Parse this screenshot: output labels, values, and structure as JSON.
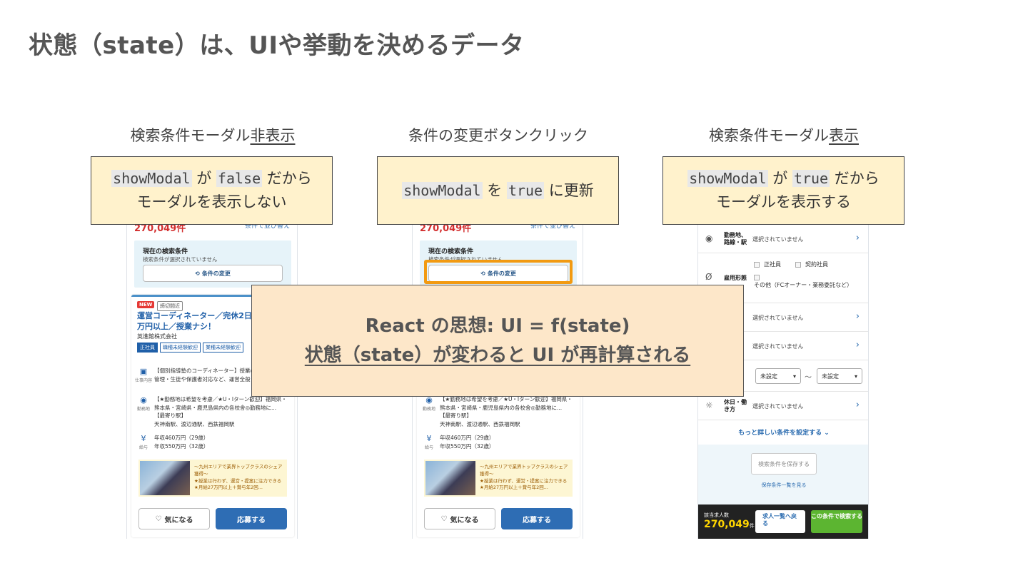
{
  "slide": {
    "title": "状態（state）は、UIや挙動を決めるデータ"
  },
  "columns": [
    {
      "title_pre": "検索条件モーダル",
      "title_emph": "非表示",
      "note_code1": "showModal",
      "note_mid": " が ",
      "note_code2": "false",
      "note_post": " だから",
      "note_line2": "モーダルを表示しない"
    },
    {
      "title_pre": "条件の変更ボタンクリック",
      "title_emph": "",
      "note_code1": "showModal",
      "note_mid": " を ",
      "note_code2": "true",
      "note_post": " に更新",
      "note_line2": ""
    },
    {
      "title_pre": "検索条件モーダル",
      "title_emph": "表示",
      "note_code1": "showModal",
      "note_mid": " が ",
      "note_code2": "true",
      "note_post": " だから",
      "note_line2": "モーダルを表示する"
    }
  ],
  "overlay": {
    "line1": "React の思想: UI = f(state)",
    "line2": "状態（state）が変わると UI が再計算される"
  },
  "phone_list": {
    "count_peek": "270,049件",
    "sort_peek": "条件で並び替え",
    "current_conditions_title": "現在の検索条件",
    "current_conditions_sub": "検索条件が選択されていません",
    "change_button": "条件の変更",
    "badge_new": "NEW",
    "badge_close": "締切間近",
    "job_title": "運営コーディネーター／完休2日／月給27万円以上／授業ナシ！",
    "company": "英進館株式会社",
    "tags": [
      "正社員",
      "職種未経験歓迎",
      "業種未経験歓迎"
    ],
    "work_label": "仕事内容",
    "work_text": "【個別指導塾のコーディネーター】授業の運営・講師の管理・生徒や保護者対応など、運営全般",
    "location_label": "勤務地",
    "location_text": "【★勤務地は希望を考慮／★U・Iターン歓迎】福岡県・熊本県・宮崎県・鹿児島県内の各校舎◎勤務地に...",
    "station_label": "【最寄り駅】",
    "station_text": "天神南駅、渡辺通駅、西鉄福岡駅",
    "salary_label": "給与",
    "salary_line1": "年収460万円（29歳）",
    "salary_line2": "年収550万円（32歳）",
    "promo_line1": "〜九州エリアで業界トップクラスのシェア獲得〜",
    "promo_line2": "★授業は行わず、運営・提案に注力できる",
    "promo_line3": "★月給27万円以上＋賞与年2回...",
    "fav_button": "気になる",
    "apply_button": "応募する"
  },
  "phone_modal": {
    "location_label": "勤務地、路線・駅",
    "not_selected": "選択されていません",
    "employment_label": "雇用形態",
    "emp_option1": "正社員",
    "emp_option2": "契約社員",
    "emp_option3": "その他（FCオーナー・業務委託など）",
    "select_unset": "未設定",
    "range_sep": "〜",
    "holiday_label": "休日・働き方",
    "more_link": "もっと詳しい条件を設定する",
    "save_button": "検索条件を保存する",
    "save_list": "保存条件一覧を見る",
    "total_label": "該当求人数",
    "total_count": "270,049",
    "total_unit": "件",
    "back_button": "求人一覧へ戻る",
    "search_button": "この条件で検索する"
  },
  "colors": {
    "note_bg": "#fff2cc",
    "overlay_bg": "#fde7c9",
    "highlight": "#f29a11",
    "accent_blue": "#2e6db4"
  }
}
